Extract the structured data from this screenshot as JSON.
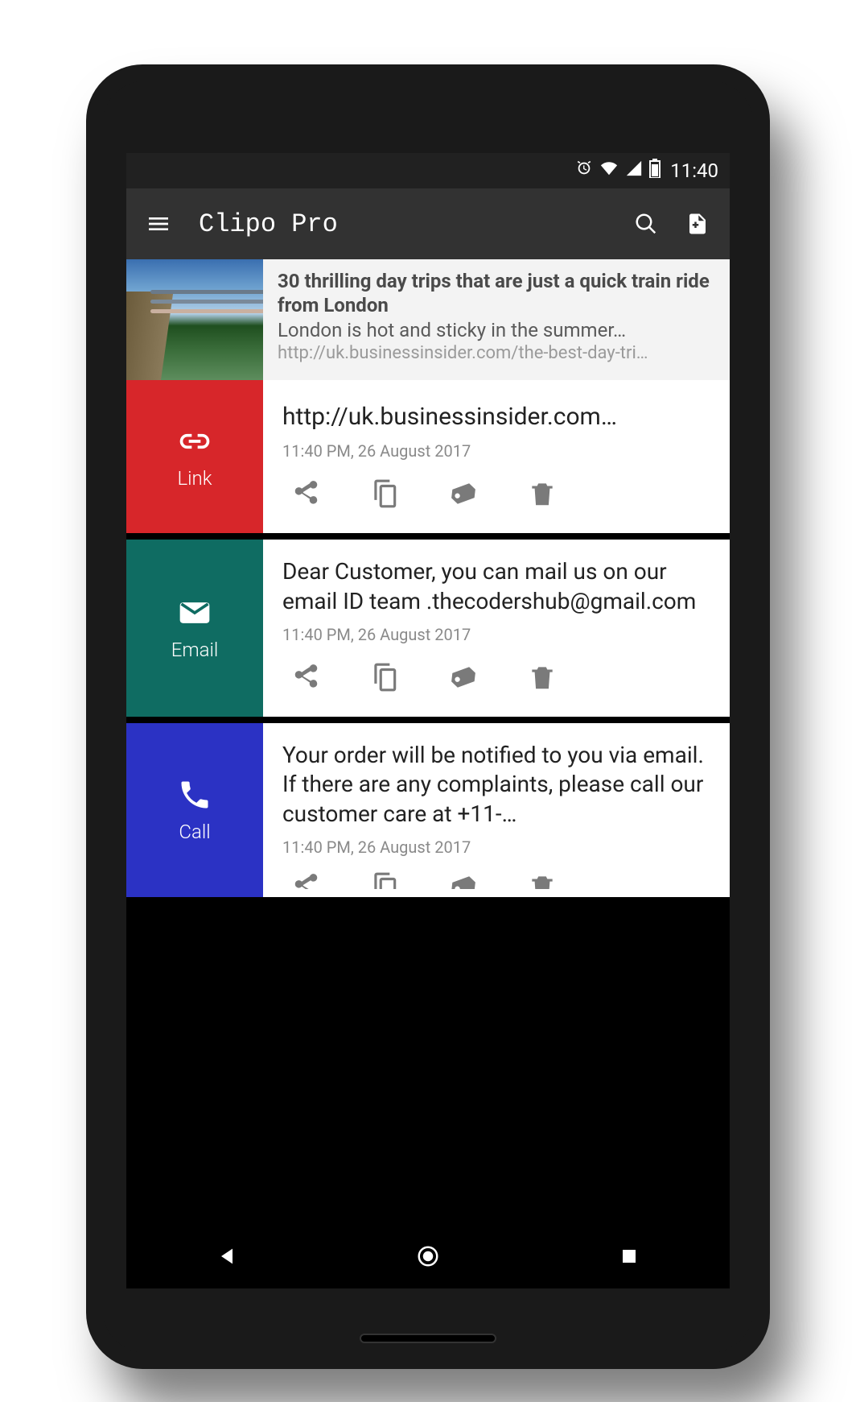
{
  "status": {
    "time": "11:40"
  },
  "appbar": {
    "title": "Clipo Pro"
  },
  "preview": {
    "title": "30 thrilling day trips that are just a quick train ride from London",
    "desc": "London is hot and sticky in the summer…",
    "url": "http://uk.businessinsider.com/the-best-day-tri…"
  },
  "clips": [
    {
      "tag": "Link",
      "color": "#d7262a",
      "content": "http://uk.businessinsider.com…",
      "time": "11:40 PM, 26 August 2017"
    },
    {
      "tag": "Email",
      "color": "#0f6c62",
      "content": "Dear Customer, you can mail us on our email ID team .thecodershub@gmail.com",
      "time": "11:40 PM, 26 August 2017"
    },
    {
      "tag": "Call",
      "color": "#2b32c4",
      "content": "Your order will be notified to you via email. If there are any complaints, please call our customer care at +11-…",
      "time": "11:40 PM, 26 August 2017"
    }
  ],
  "actions": {
    "share": "share-icon",
    "copy": "copy-icon",
    "tag": "tag-icon",
    "delete": "delete-icon"
  }
}
